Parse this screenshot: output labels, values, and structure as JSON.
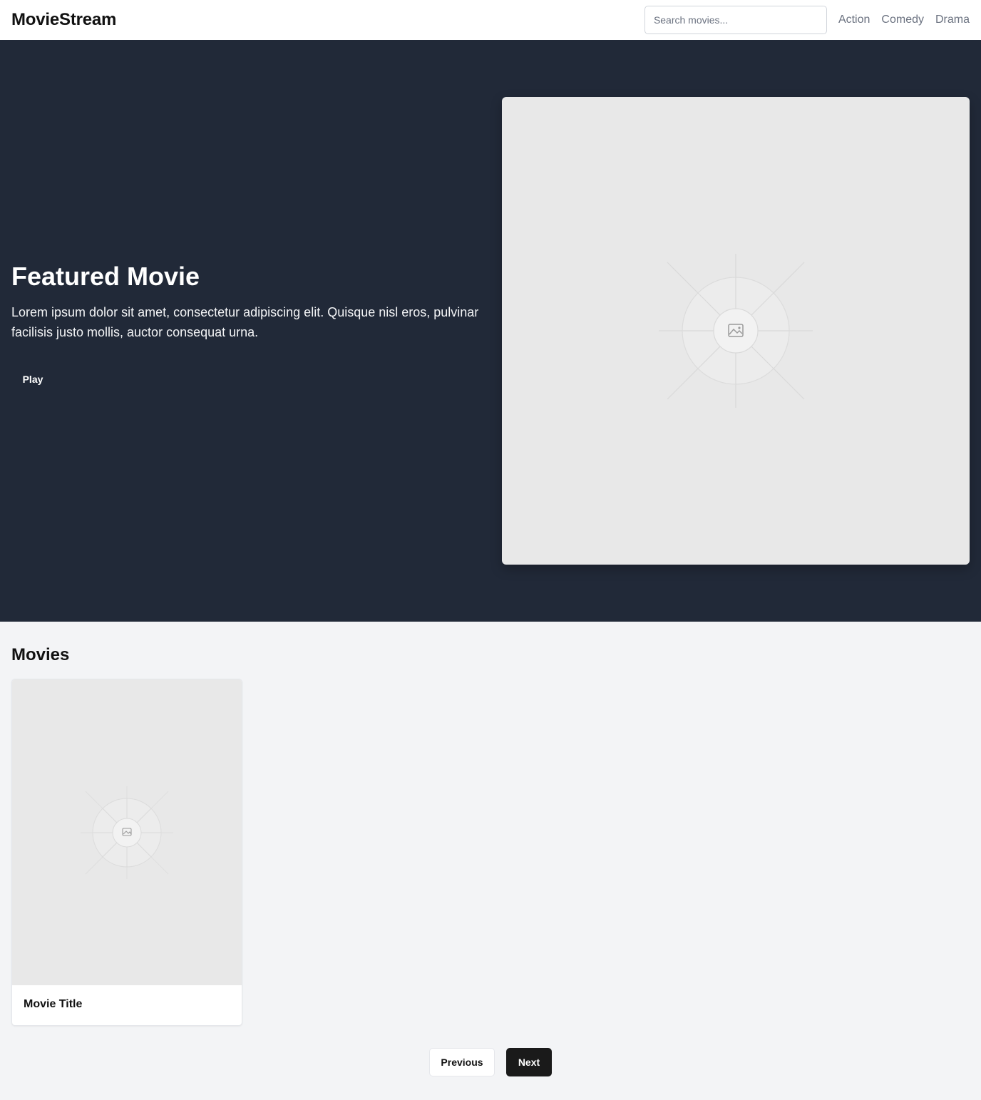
{
  "header": {
    "brand": "MovieStream",
    "search_placeholder": "Search movies...",
    "search_value": "",
    "nav": [
      "Action",
      "Comedy",
      "Drama"
    ]
  },
  "hero": {
    "title": "Featured Movie",
    "description": "Lorem ipsum dolor sit amet, consectetur adipiscing elit. Quisque nisl eros, pulvinar facilisis justo mollis, auctor consequat urna.",
    "play_label": "Play",
    "image_icon": "image-placeholder-icon"
  },
  "movies": {
    "section_title": "Movies",
    "items": [
      {
        "title": "Movie Title",
        "image_icon": "image-placeholder-icon"
      }
    ]
  },
  "pagination": {
    "previous_label": "Previous",
    "next_label": "Next"
  },
  "colors": {
    "hero_bg": "#212938",
    "page_bg": "#f3f4f6",
    "placeholder_bg": "#e8e8e8",
    "next_button_bg": "#1a1a1a",
    "nav_text": "#6b7280"
  }
}
